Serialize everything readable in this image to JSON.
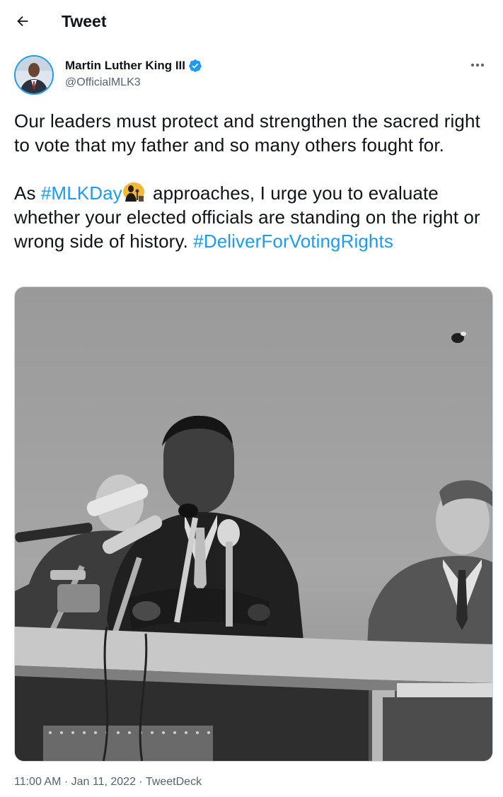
{
  "header": {
    "back_icon": "arrow-left-icon",
    "title": "Tweet"
  },
  "author": {
    "display_name": "Martin Luther King III",
    "handle": "@OfficialMLK3",
    "verified": true,
    "verified_icon": "verified-badge-icon",
    "more_icon": "more-horizontal-icon"
  },
  "tweet": {
    "paragraph_1": "Our leaders must protect and strengthen the sacred right to vote that my father and so many others fought for.",
    "para2_prefix": "As ",
    "hashtag_1": "#MLKDay",
    "emoji_icon": "mlkday-emoji-icon",
    "para2_middle": " approaches, I urge you to evaluate whether your elected officials are standing on the right or wrong side of history.  ",
    "hashtag_2": "#DeliverForVotingRights"
  },
  "meta": {
    "time": "11:00 AM",
    "separator": " · ",
    "date": "Jan 11, 2022",
    "source": "TweetDeck"
  },
  "colors": {
    "link": "#1d9bf0",
    "text": "#0f1419",
    "secondary": "#536471"
  }
}
